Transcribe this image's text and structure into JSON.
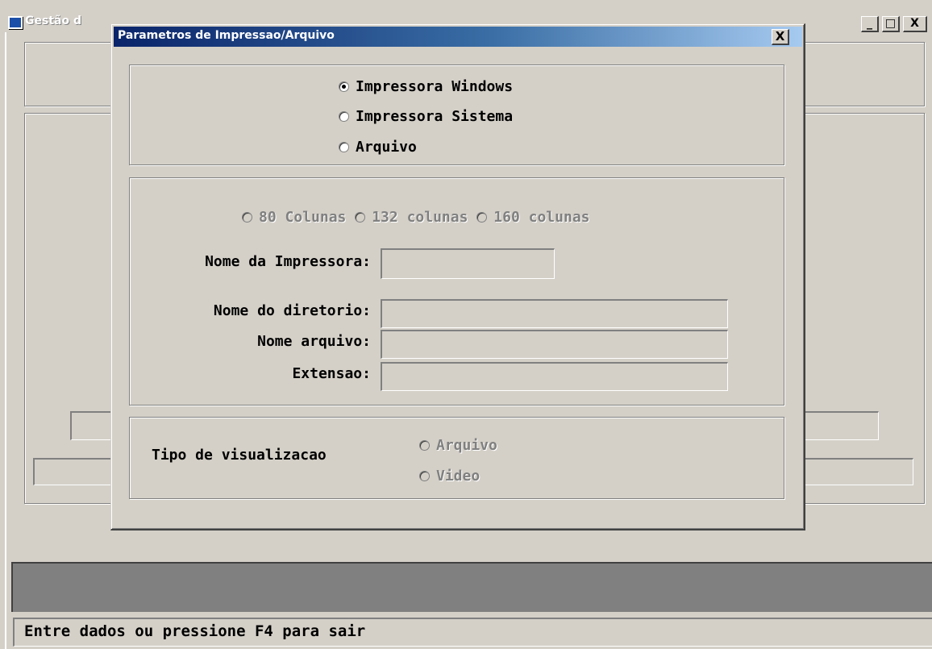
{
  "main_window": {
    "title": "Gestão d",
    "buttons": {
      "minimize": "_",
      "maximize": "□",
      "close": "X"
    }
  },
  "dialog": {
    "title": "Parametros de Impressao/Arquivo",
    "close": "X",
    "output_options": [
      {
        "label": "Impressora Windows",
        "checked": true
      },
      {
        "label": "Impressora Sistema",
        "checked": false
      },
      {
        "label": "Arquivo",
        "checked": false
      }
    ],
    "columns_options": [
      {
        "label": "80 Colunas",
        "enabled": false
      },
      {
        "label": "132 colunas",
        "enabled": false
      },
      {
        "label": "160 colunas",
        "enabled": false
      }
    ],
    "printer_name_label": "Nome da Impressora:",
    "printer_name_value": "",
    "directory_label": "Nome do diretorio:",
    "directory_value": "",
    "file_name_label": "Nome arquivo:",
    "file_name_value": "",
    "extension_label": "Extensao:",
    "extension_value": "",
    "view_type_label": "Tipo de visualizacao",
    "view_options": [
      {
        "label": "Arquivo",
        "enabled": false
      },
      {
        "label": "Video",
        "enabled": false
      }
    ]
  },
  "status": {
    "message": "Entre dados ou pressione F4 para sair"
  }
}
